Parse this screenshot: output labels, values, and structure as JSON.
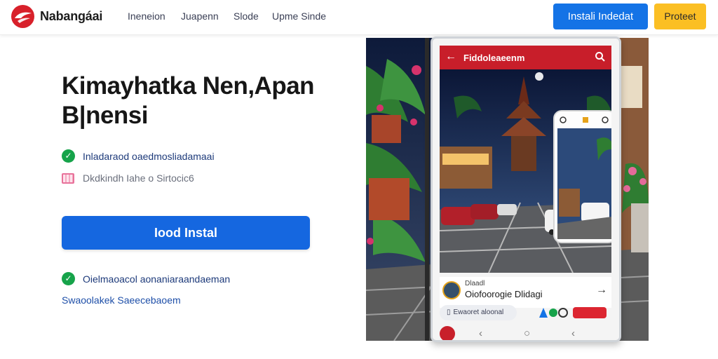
{
  "header": {
    "brand": "Nabangáai",
    "nav": [
      "Ineneion",
      "Juapenn",
      "Slode",
      "Upme Sinde"
    ],
    "install_label": "Instali Indedat",
    "protect_label": "Proteet"
  },
  "hero": {
    "headline_line1": "Kimayhatka Nen,Apan",
    "headline_line2": "B|nensi",
    "feature1": "Inladaraod oaedmosliadamaai",
    "feature2": "Dkdkindh Iahe o Sirtocic6",
    "cta_label": "Iood Instal",
    "feature3": "Oielmaoacol aonaniaraandaeman",
    "security_link": "Swaoolakek Saeecebaoem"
  },
  "phone": {
    "app_title": "Fiddoleaeenm",
    "author_small": "Dlaadl",
    "author_name": "Oiofoorogie Dlidagi",
    "pill_text": "Ewaoret aloonal"
  },
  "colors": {
    "primary_blue": "#1473e6",
    "cta_blue": "#1567e0",
    "accent_yellow": "#fbbf24",
    "brand_red": "#d8202a",
    "app_red": "#c81e2a",
    "check_green": "#16a34a"
  },
  "icons": {
    "logo": "brand-bird-logo",
    "check": "check-circle-icon",
    "calendar": "calendar-icon",
    "back": "back-arrow-icon",
    "search": "search-icon",
    "forward": "forward-arrow-icon"
  }
}
